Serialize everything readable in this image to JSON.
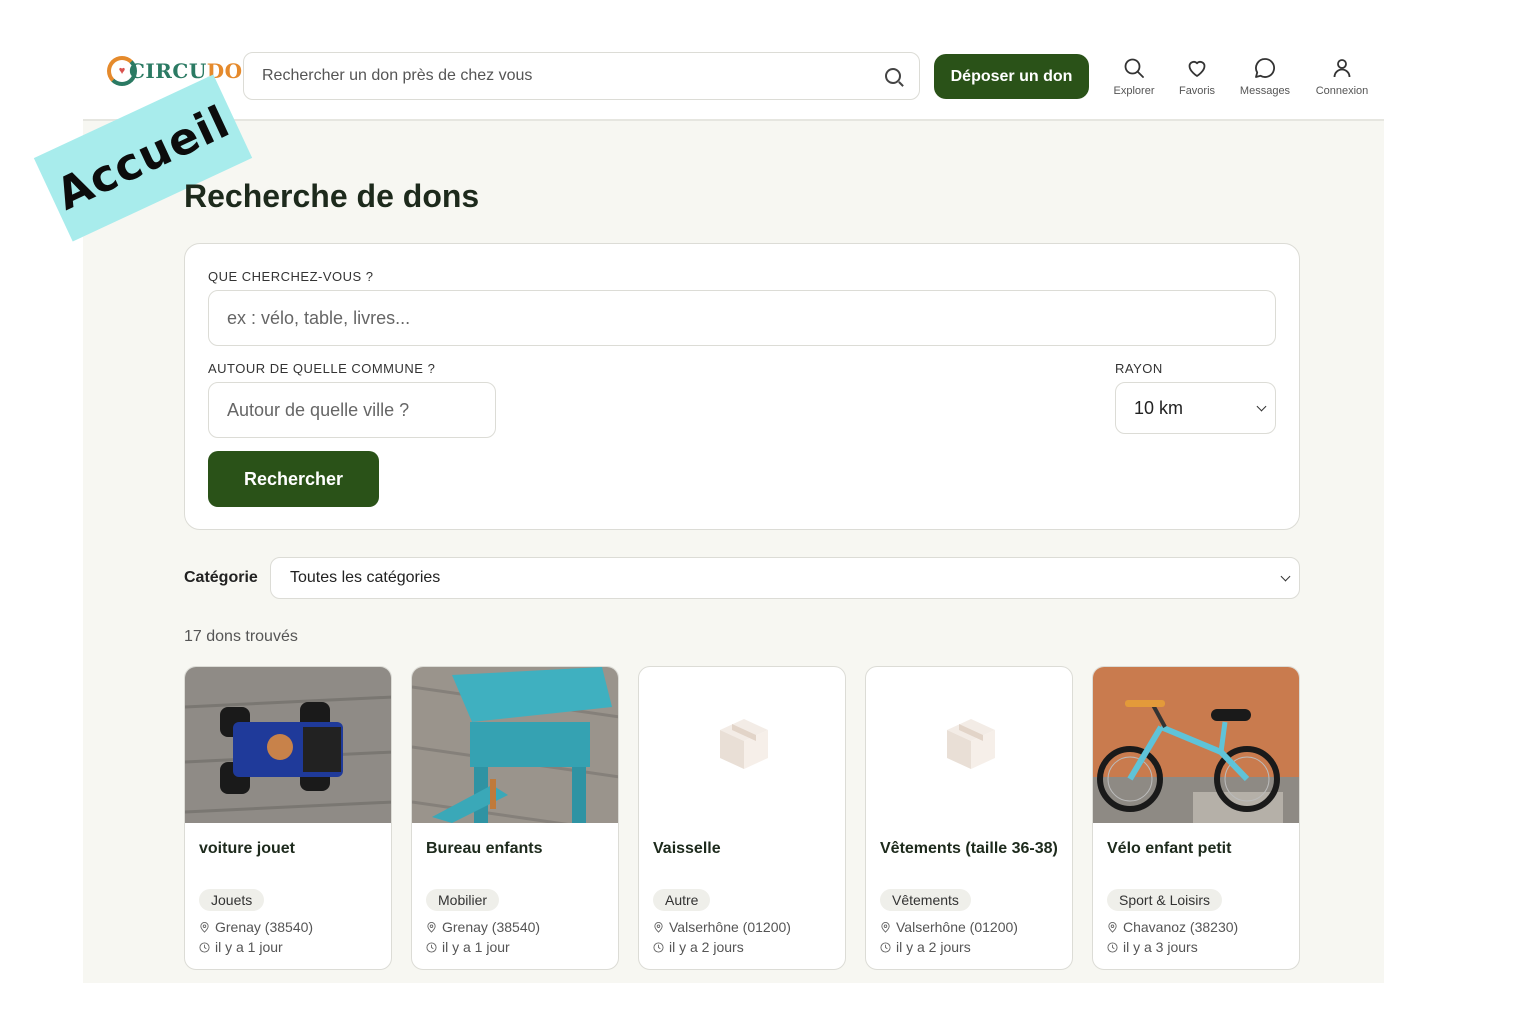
{
  "header": {
    "logo": "CircuDon",
    "search_placeholder": "Rechercher un don près de chez vous",
    "donate_label": "Déposer un don",
    "nav": [
      {
        "label": "Explorer",
        "icon": "search-icon"
      },
      {
        "label": "Favoris",
        "icon": "heart-icon"
      },
      {
        "label": "Messages",
        "icon": "chat-icon"
      },
      {
        "label": "Connexion",
        "icon": "user-icon"
      }
    ]
  },
  "sticker": "Accueil",
  "page_title": "Recherche de dons",
  "form": {
    "what_label": "QUE CHERCHEZ-VOUS ?",
    "what_placeholder": "ex : vélo, table, livres...",
    "where_label": "AUTOUR DE QUELLE COMMUNE ?",
    "where_placeholder": "Autour de quelle ville ?",
    "radius_label": "RAYON",
    "radius_value": "10 km",
    "submit_label": "Rechercher"
  },
  "category": {
    "label": "Catégorie",
    "value": "Toutes les catégories"
  },
  "results_count": "17 dons trouvés",
  "cards": [
    {
      "title": "voiture jouet",
      "category": "Jouets",
      "location": "Grenay (38540)",
      "time": "il y a 1 jour",
      "image": "toy-car-photo"
    },
    {
      "title": "Bureau enfants",
      "category": "Mobilier",
      "location": "Grenay (38540)",
      "time": "il y a 1 jour",
      "image": "blue-desk-photo"
    },
    {
      "title": "Vaisselle",
      "category": "Autre",
      "location": "Valserhône (01200)",
      "time": "il y a 2 jours",
      "image": "box-placeholder"
    },
    {
      "title": "Vêtements (taille 36-38)",
      "category": "Vêtements",
      "location": "Valserhône (01200)",
      "time": "il y a 2 jours",
      "image": "box-placeholder"
    },
    {
      "title": "Vélo enfant petit",
      "category": "Sport & Loisirs",
      "location": "Chavanoz (38230)",
      "time": "il y a 3 jours",
      "image": "kids-bike-photo"
    }
  ],
  "colors": {
    "primary": "#2a5218",
    "background": "#f7f7f2",
    "sticker": "#a8ecec",
    "logo_orange": "#e58a2c",
    "logo_teal": "#2b7a63"
  }
}
